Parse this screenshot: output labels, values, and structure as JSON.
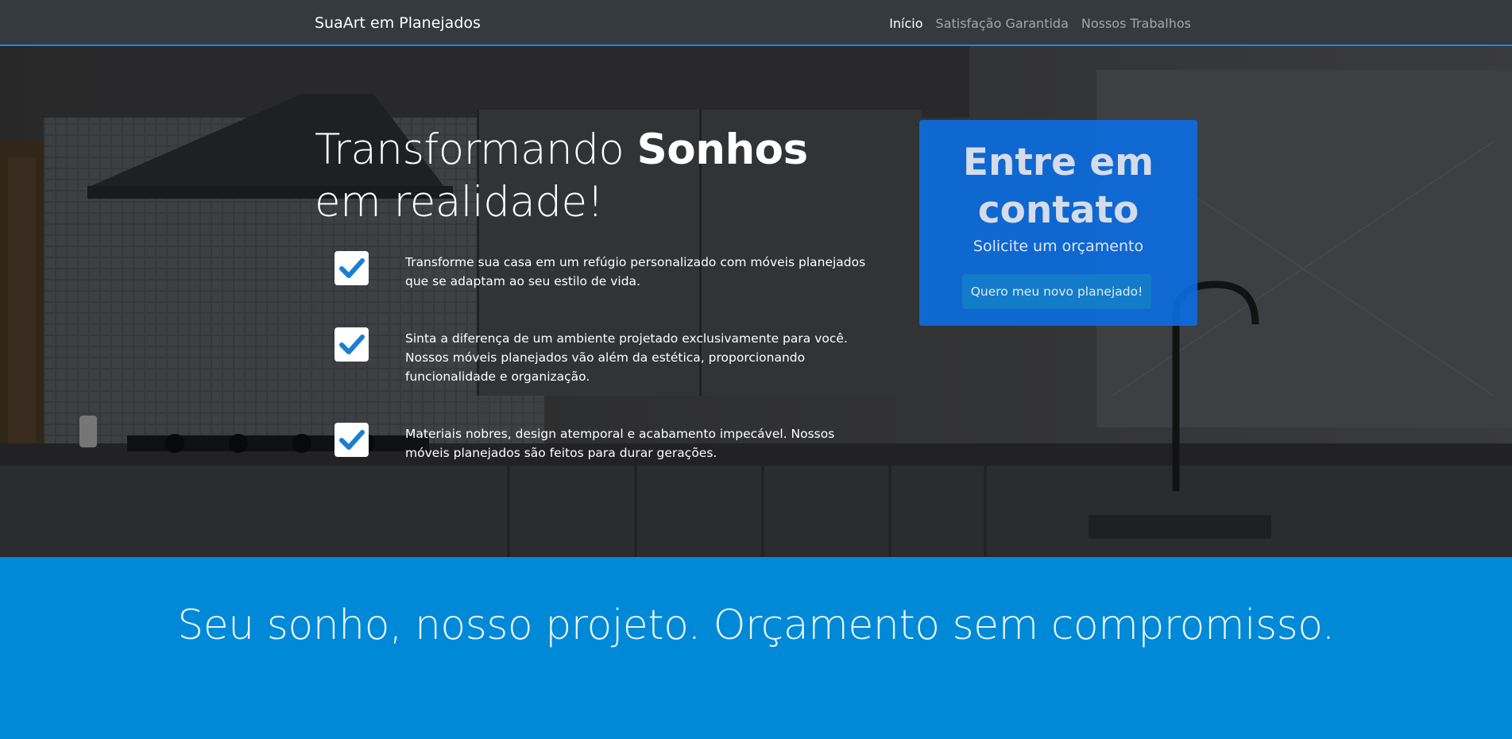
{
  "nav": {
    "brand": "SuaArt em Planejados",
    "links": [
      "Início",
      "Satisfação Garantida",
      "Nossos Trabalhos"
    ]
  },
  "hero": {
    "headline_part1": "Transformando ",
    "headline_bold": "Sonhos",
    "headline_part2": " em realidade!",
    "features": [
      "Transforme sua casa em um refúgio personalizado com móveis planejados que se adaptam ao seu estilo de vida.",
      "Sinta a diferença de um ambiente projetado exclusivamente para você. Nossos móveis planejados vão além da estética, proporcionando funcionalidade e organização.",
      "Materiais nobres, design atemporal e acabamento impecável. Nossos móveis planejados são feitos para durar gerações."
    ]
  },
  "contact": {
    "title": "Entre em contato",
    "subtitle": "Solicite um orçamento",
    "button": "Quero meu novo planejado!"
  },
  "banner": {
    "text": "Seu sonho, nosso projeto. Orçamento sem compromisso."
  },
  "colors": {
    "navbar": "#343a40",
    "accent": "#0089d6",
    "card": "#0a6ee6",
    "check": "#1a7fd1"
  },
  "icons": [
    "checkbox-checked-icon"
  ]
}
